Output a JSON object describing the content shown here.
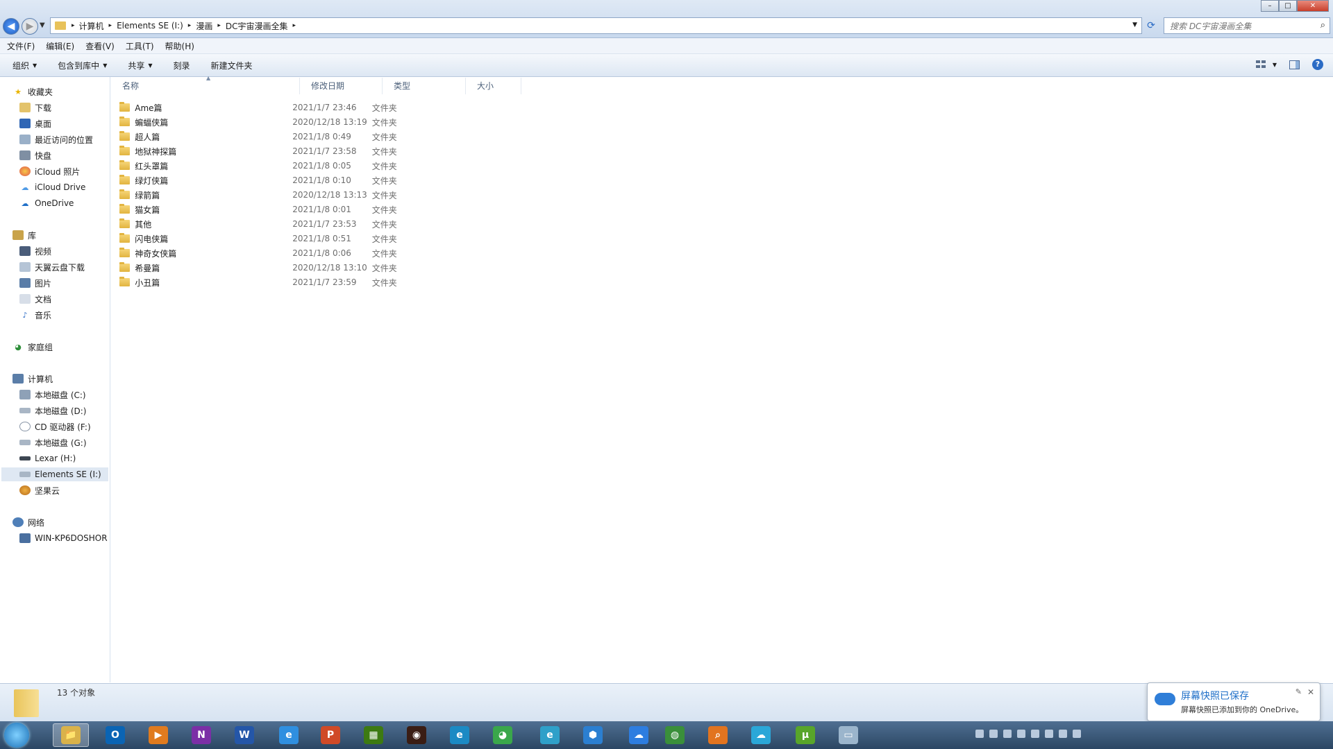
{
  "window": {
    "breadcrumb": [
      "计算机",
      "Elements SE (I:)",
      "漫画",
      "DC宇宙漫画全集"
    ],
    "search_placeholder": "搜索 DC宇宙漫画全集",
    "controls": {
      "minimize": "–",
      "maximize": "□",
      "close": "✕"
    }
  },
  "menu": [
    "文件(F)",
    "编辑(E)",
    "查看(V)",
    "工具(T)",
    "帮助(H)"
  ],
  "toolbar": {
    "organize": "组织",
    "include_library": "包含到库中",
    "share": "共享",
    "burn": "刻录",
    "new_folder": "新建文件夹",
    "help": "?"
  },
  "nav": {
    "favorites": {
      "label": "收藏夹",
      "items": [
        "下载",
        "桌面",
        "最近访问的位置",
        "快盘",
        "iCloud 照片",
        "iCloud Drive",
        "OneDrive"
      ]
    },
    "libraries": {
      "label": "库",
      "items": [
        "视频",
        "天翼云盘下载",
        "图片",
        "文档",
        "音乐"
      ]
    },
    "homegroup": "家庭组",
    "computer": {
      "label": "计算机",
      "items": [
        "本地磁盘 (C:)",
        "本地磁盘 (D:)",
        "CD 驱动器 (F:)",
        "本地磁盘 (G:)",
        "Lexar (H:)",
        "Elements SE (I:)",
        "坚果云"
      ]
    },
    "network": {
      "label": "网络",
      "items": [
        "WIN-KP6DOSHOR"
      ]
    }
  },
  "columns": {
    "name": "名称",
    "date": "修改日期",
    "type": "类型",
    "size": "大小"
  },
  "files": [
    {
      "name": "Ame篇",
      "date": "2021/1/7 23:46",
      "type": "文件夹"
    },
    {
      "name": "蝙蝠侠篇",
      "date": "2020/12/18 13:19",
      "type": "文件夹"
    },
    {
      "name": "超人篇",
      "date": "2021/1/8 0:49",
      "type": "文件夹"
    },
    {
      "name": "地狱神探篇",
      "date": "2021/1/7 23:58",
      "type": "文件夹"
    },
    {
      "name": "红头罩篇",
      "date": "2021/1/8 0:05",
      "type": "文件夹"
    },
    {
      "name": "绿灯侠篇",
      "date": "2021/1/8 0:10",
      "type": "文件夹"
    },
    {
      "name": "绿箭篇",
      "date": "2020/12/18 13:13",
      "type": "文件夹"
    },
    {
      "name": "猫女篇",
      "date": "2021/1/8 0:01",
      "type": "文件夹"
    },
    {
      "name": "其他",
      "date": "2021/1/7 23:53",
      "type": "文件夹"
    },
    {
      "name": "闪电侠篇",
      "date": "2021/1/8 0:51",
      "type": "文件夹"
    },
    {
      "name": "神奇女侠篇",
      "date": "2021/1/8 0:06",
      "type": "文件夹"
    },
    {
      "name": "希曼篇",
      "date": "2020/12/18 13:10",
      "type": "文件夹"
    },
    {
      "name": "小丑篇",
      "date": "2021/1/7 23:59",
      "type": "文件夹"
    }
  ],
  "status": {
    "count": "13 个对象"
  },
  "toast": {
    "title": "屏幕快照已保存",
    "body": "屏幕快照已添加到你的 OneDrive。"
  },
  "taskbar_apps": [
    {
      "icon": "explorer-icon",
      "color": "#d9b24a",
      "glyph": "📁"
    },
    {
      "icon": "outlook-icon",
      "color": "#0a64b4",
      "glyph": "O"
    },
    {
      "icon": "media-player-icon",
      "color": "#e07b1f",
      "glyph": "▶"
    },
    {
      "icon": "onenote-icon",
      "color": "#7b2fa6",
      "glyph": "N"
    },
    {
      "icon": "word-icon",
      "color": "#2456a8",
      "glyph": "W"
    },
    {
      "icon": "internet-explorer-icon",
      "color": "#2f8fe0",
      "glyph": "e"
    },
    {
      "icon": "powerpoint-icon",
      "color": "#d04a27",
      "glyph": "P"
    },
    {
      "icon": "nvidia-icon",
      "color": "#3d7a12",
      "glyph": "▦"
    },
    {
      "icon": "speaker-app-icon",
      "color": "#3a1d14",
      "glyph": "◉"
    },
    {
      "icon": "edge-beta-icon",
      "color": "#1b8ac4",
      "glyph": "e"
    },
    {
      "icon": "chrome-icon",
      "color": "#3aa74b",
      "glyph": "◕"
    },
    {
      "icon": "browser-icon",
      "color": "#2fa0c9",
      "glyph": "e"
    },
    {
      "icon": "network-app-icon",
      "color": "#2b7fd1",
      "glyph": "⬢"
    },
    {
      "icon": "baidu-netdisk-icon",
      "color": "#2d7de0",
      "glyph": "☁"
    },
    {
      "icon": "globe-app-icon",
      "color": "#3a8f3a",
      "glyph": "◍"
    },
    {
      "icon": "search-app-icon",
      "color": "#e2741f",
      "glyph": "⌕"
    },
    {
      "icon": "cloud-sync-icon",
      "color": "#2aa7d8",
      "glyph": "☁"
    },
    {
      "icon": "utorrent-icon",
      "color": "#58a52a",
      "glyph": "µ"
    },
    {
      "icon": "notes-app-icon",
      "color": "#9bb5cc",
      "glyph": "▭"
    }
  ]
}
